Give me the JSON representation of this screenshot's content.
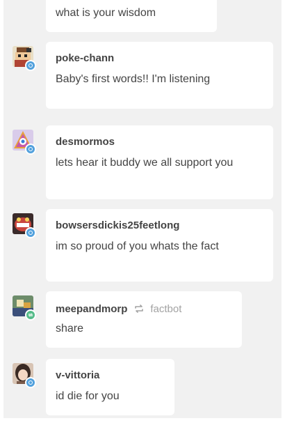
{
  "notes": [
    {
      "id": "top",
      "username": "",
      "text": "what is your wisdom"
    },
    {
      "id": "poke-chann",
      "username": "poke-chann",
      "type": "reply",
      "text": "Baby's first words!! I'm listening"
    },
    {
      "id": "desmormos",
      "username": "desmormos",
      "type": "reply",
      "text": "lets hear it buddy we all support you"
    },
    {
      "id": "bowsersdickis25feetlong",
      "username": "bowsersdickis25feetlong",
      "type": "reply",
      "text": "im so proud of you whats the fact"
    },
    {
      "id": "meepandmorp",
      "username": "meepandmorp",
      "type": "reblog",
      "reblog_source": "factbot",
      "text": "share"
    },
    {
      "id": "v-vittoria",
      "username": "v-vittoria",
      "type": "reply",
      "text": "id die for you"
    }
  ],
  "colors": {
    "background": "#f1f1f1",
    "bubble": "#ffffff",
    "text": "#444444",
    "muted": "#a2a2a2",
    "reply_badge": "#52a1dd",
    "reblog_badge": "#56bc8a"
  }
}
